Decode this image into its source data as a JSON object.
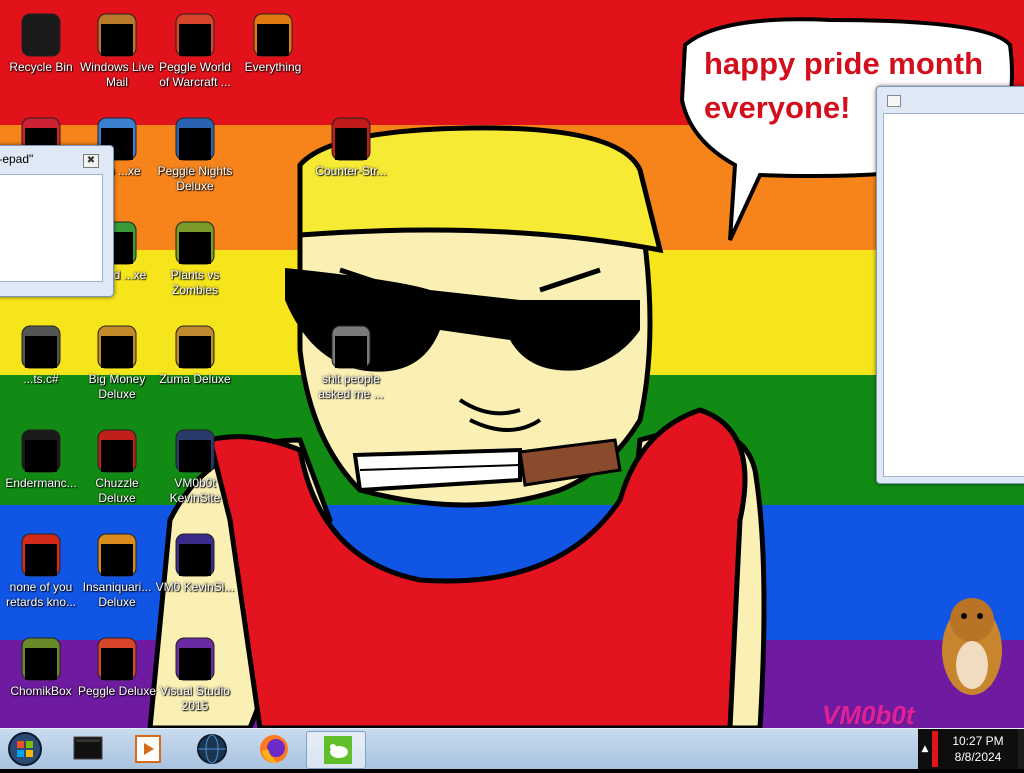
{
  "wallpaper": {
    "stripe_colors": [
      "#e2121b",
      "#f7841b",
      "#f6e51b",
      "#128b14",
      "#1155e5",
      "#6e1ba1"
    ],
    "speech_bubble_line1": "happy pride month",
    "speech_bubble_line2": "everyone!",
    "signature": "VM0b0t"
  },
  "desktop_icons": [
    {
      "label": "Recycle Bin",
      "icon": "recycle-bin-icon"
    },
    {
      "label": "Windows Live Mail",
      "icon": "mail-icon"
    },
    {
      "label": "Peggle World of Warcraft ...",
      "icon": "peggle-icon"
    },
    {
      "label": "Everything",
      "icon": "search-app-icon"
    },
    {
      "label": "",
      "icon": "app-icon"
    },
    {
      "label": "Pop ...xe",
      "icon": "game-icon"
    },
    {
      "label": "Peggle Nights Deluxe",
      "icon": "peggle-icon"
    },
    {
      "label": "Counter-Str...",
      "icon": "game-icon"
    },
    {
      "label": "...eled ...xe",
      "icon": "game-icon"
    },
    {
      "label": "Plants vs Zombies",
      "icon": "game-icon"
    },
    {
      "label": "...ts.c#",
      "icon": "file-icon"
    },
    {
      "label": "Big Money Deluxe",
      "icon": "game-icon"
    },
    {
      "label": "Zuma Deluxe",
      "icon": "game-icon"
    },
    {
      "label": "shit people asked me ...",
      "icon": "folder-icon"
    },
    {
      "label": "Endermanc...",
      "icon": "terminal-icon"
    },
    {
      "label": "Chuzzle Deluxe",
      "icon": "game-icon"
    },
    {
      "label": "VM0b0t KevinSite",
      "icon": "site-icon"
    },
    {
      "label": "none of you retards kno...",
      "icon": "app-icon"
    },
    {
      "label": "Insaniquari... Deluxe",
      "icon": "game-icon"
    },
    {
      "label": "VM0 KevinSi...",
      "icon": "site-icon"
    },
    {
      "label": "ChomikBox",
      "icon": "chomikbox-icon"
    },
    {
      "label": "Peggle Deluxe",
      "icon": "peggle-icon"
    },
    {
      "label": "Visual Studio 2015",
      "icon": "visual-studio-icon"
    }
  ],
  "windows": {
    "left_title": "t-epad\"",
    "left_close": "✖"
  },
  "taskbar": {
    "pinned": [
      "terminal-app-icon",
      "media-player-icon",
      "globe-app-icon",
      "firefox-icon",
      "goose-app-icon"
    ],
    "tray_arrow": "▲",
    "clock_time": "10:27 PM",
    "clock_date": "8/8/2024"
  }
}
